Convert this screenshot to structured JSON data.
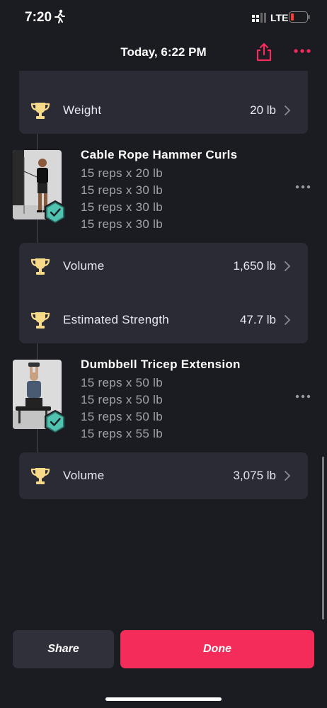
{
  "status_bar": {
    "time": "7:20",
    "network": "LTE"
  },
  "header": {
    "title": "Today, 6:22 PM"
  },
  "stat_cards": [
    {
      "rows": [
        {
          "label": "Weight",
          "value": "20 lb"
        }
      ]
    },
    {
      "rows": [
        {
          "label": "Volume",
          "value": "1,650 lb"
        },
        {
          "label": "Estimated Strength",
          "value": "47.7 lb"
        }
      ]
    },
    {
      "rows": [
        {
          "label": "Volume",
          "value": "3,075 lb"
        }
      ]
    }
  ],
  "exercises": [
    {
      "name": "Cable Rope Hammer Curls",
      "sets": [
        "15 reps x 20 lb",
        "15 reps x 30 lb",
        "15 reps x 30 lb",
        "15 reps x 30 lb"
      ],
      "completed": true
    },
    {
      "name": "Dumbbell Tricep Extension",
      "sets": [
        "15 reps x 50 lb",
        "15 reps x 50 lb",
        "15 reps x 50 lb",
        "15 reps x 55 lb"
      ],
      "completed": true
    }
  ],
  "buttons": {
    "share": "Share",
    "done": "Done"
  },
  "icons": {
    "trophy": "trophy-icon",
    "chevron": "chevron-right-icon",
    "share": "share-icon",
    "more": "more-icon",
    "check": "check-badge-icon",
    "run": "running-icon"
  },
  "colors": {
    "background": "#1b1b22",
    "card": "#2b2b35",
    "accent": "#f32c5a",
    "trophy": "#f7d98a",
    "check": "#4fc3b0"
  }
}
